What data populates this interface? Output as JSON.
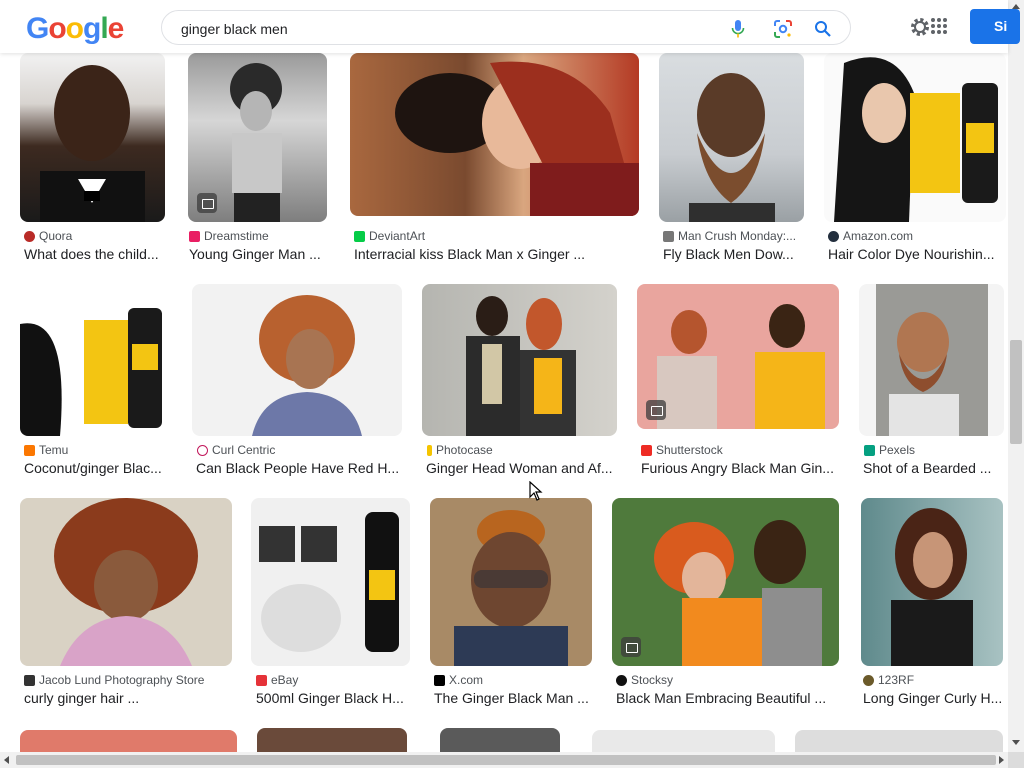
{
  "logo": {
    "letters": [
      "G",
      "o",
      "o",
      "g",
      "l",
      "e"
    ],
    "colors": [
      "#4285F4",
      "#EA4335",
      "#FBBC05",
      "#4285F4",
      "#34A853",
      "#EA4335"
    ]
  },
  "search": {
    "value": "ginger black men",
    "mic_icon": "mic-icon",
    "lens_icon": "lens-icon",
    "search_icon": "search-icon"
  },
  "header": {
    "settings_icon": "gear-icon",
    "apps_icon": "apps-grid-icon",
    "signin_label": "Si",
    "signin_color": "#1a73e8"
  },
  "results": [
    {
      "source": "Quora",
      "title": "What does the child...",
      "fav": "#b92b27"
    },
    {
      "source": "Dreamstime",
      "title": "Young Ginger Man ...",
      "fav": "#e91e63"
    },
    {
      "source": "DeviantArt",
      "title": "Interracial kiss Black Man x Ginger ...",
      "fav": "#05cc47"
    },
    {
      "source": "Man Crush Monday:...",
      "title": "Fly Black Men Dow...",
      "fav": "#777777"
    },
    {
      "source": "Amazon.com",
      "title": "Hair Color Dye Nourishin...",
      "fav": "#232f3e"
    },
    {
      "source": "Temu",
      "title": "Coconut/ginger Blac...",
      "fav": "#fb7701"
    },
    {
      "source": "Curl Centric",
      "title": "Can Black People Have Red H...",
      "fav": "#c2185b"
    },
    {
      "source": "Photocase",
      "title": "Ginger Head Woman and Af...",
      "fav": "#f5c400"
    },
    {
      "source": "Shutterstock",
      "title": "Furious Angry Black Man Gin...",
      "fav": "#ee2b24"
    },
    {
      "source": "Pexels",
      "title": "Shot of a Bearded ...",
      "fav": "#05a081"
    },
    {
      "source": "Jacob Lund Photography Store",
      "title": "curly ginger hair ...",
      "fav": "#333333"
    },
    {
      "source": "eBay",
      "title": "500ml Ginger Black H...",
      "fav": "#e53238"
    },
    {
      "source": "X.com",
      "title": "The Ginger Black Man ...",
      "fav": "#000000"
    },
    {
      "source": "Stocksy",
      "title": "Black Man Embracing Beautiful ...",
      "fav": "#111111"
    },
    {
      "source": "123RF",
      "title": "Long Ginger Curly H...",
      "fav": "#6b5a2a"
    }
  ]
}
